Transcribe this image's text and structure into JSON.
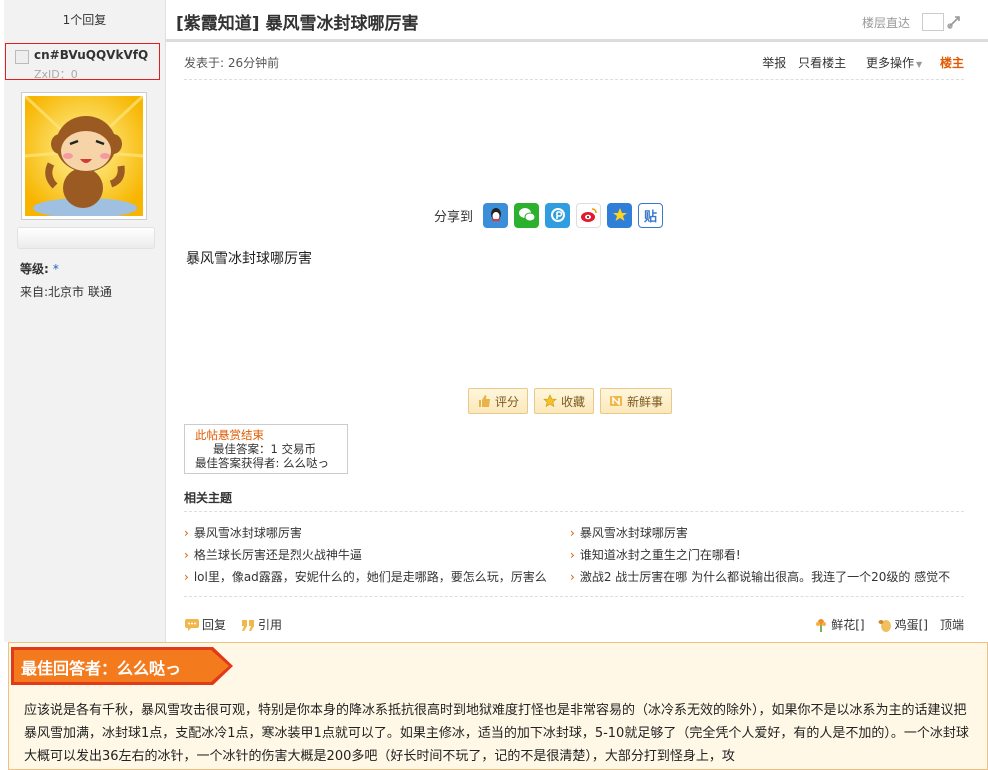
{
  "header": {
    "reply_count": "1个回复",
    "title": "[紫霞知道] 暴风雪冰封球哪厉害",
    "floor_jump_label": "楼层直达"
  },
  "user": {
    "name": "cn#BVuQQVkVfQ",
    "zxid": "ZxID：0",
    "level_label": "等级:",
    "level_value": "*",
    "from": "来自:北京市 联通"
  },
  "post": {
    "posted": "发表于: 26分钟前",
    "ops": {
      "report": "举报",
      "only_op": "只看楼主",
      "more": "更多操作",
      "op_tag": "楼主"
    },
    "share_label": "分享到",
    "share_icons": [
      "qq-icon",
      "wechat-icon",
      "pengyou-icon",
      "weibo-icon",
      "qzone-icon",
      "tieba-icon"
    ],
    "share_tieba_char": "贴",
    "body": "暴风雪冰封球哪厉害",
    "buttons": {
      "rate": "评分",
      "favorite": "收藏",
      "fresh": "新鲜事"
    },
    "reward": {
      "status": "此帖悬赏结束",
      "best_answer": "最佳答案：1 交易币",
      "winner": "最佳答案获得者: 么么哒っ"
    }
  },
  "related": {
    "title": "相关主题",
    "items": [
      "暴风雪冰封球哪厉害",
      "暴风雪冰封球哪厉害",
      "格兰球长厉害还是烈火战神牛逼",
      "谁知道冰封之重生之门在哪看!",
      "lol里，像ad露露，安妮什么的，她们是走哪路，要怎么玩，厉害么",
      "激战2 战士厉害在哪 为什么都说输出很高。我连了一个20级的 感觉不"
    ]
  },
  "footer": {
    "reply": "回复",
    "quote": "引用",
    "flower": "鲜花[]",
    "egg": "鸡蛋[]",
    "top": "顶端"
  },
  "best_answer": {
    "tag": "最佳回答者：么么哒っ",
    "text": "应该说是各有千秋，暴风雪攻击很可观，特别是你本身的降冰系抵抗很高时到地狱难度打怪也是非常容易的（冰冷系无效的除外），如果你不是以冰系为主的话建议把暴风雪加满，冰封球1点，支配冰冷1点，寒冰装甲1点就可以了。如果主修冰，适当的加下冰封球，5-10就足够了（完全凭个人爱好，有的人是不加的）。一个冰封球大概可以发出36左右的冰针，一个冰针的伤害大概是200多吧（好长时间不玩了，记的不是很清楚），大部分打到怪身上，攻"
  }
}
